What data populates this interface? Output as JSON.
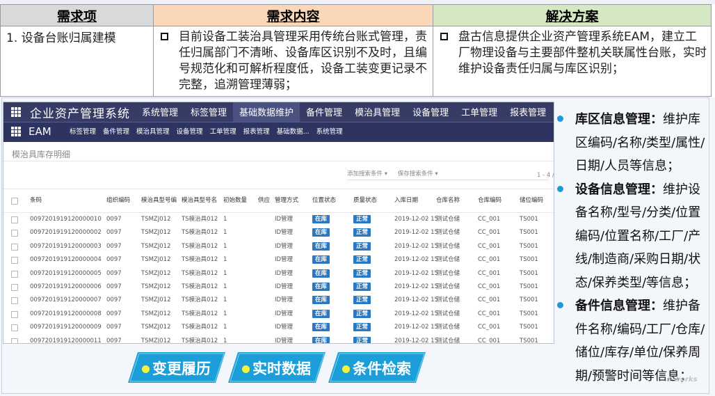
{
  "table": {
    "headers": [
      "需求项",
      "需求内容",
      "解决方案"
    ],
    "item": "1. 设备台账归属建模",
    "content": "目前设备工装治具管理采用传统台账式管理，责任归属部门不清晰、设备库区识别不及时，且编号规范化和可解析程度低，设备工装变更记录不完整，追溯管理薄弱；",
    "solution": "盘古信息提供企业资产管理系统EAM，建立工厂物理设备与主要部件整机关联属性台账，实时维护设备责任归属与库区识别；"
  },
  "app": {
    "title": "企业资产管理系统",
    "nav": [
      "系统管理",
      "标签管理",
      "基础数据维护",
      "备件管理",
      "模治具管理",
      "设备管理",
      "工单管理",
      "报表管理"
    ],
    "active_nav": "基础数据维护",
    "sub_title": "EAM",
    "sub_nav": [
      "标签管理",
      "备件管理",
      "模治具管理",
      "设备管理",
      "工单管理",
      "报表管理",
      "基础数据...",
      "系统管理"
    ],
    "page_title": "模治具库存明细",
    "add_search": "添加搜索条件 ▾",
    "saved_search": "保存搜索条件 ▾",
    "pager": "1 - 4 /",
    "columns": [
      "条码",
      "组织编码",
      "模治具型号编",
      "模治具型号名",
      "初始数量",
      "供应",
      "管理方式",
      "位置状态",
      "质量状态",
      "入库日期",
      "仓库名称",
      "仓库编码",
      "储位编码"
    ],
    "rows": [
      [
        "0097201919120000010",
        "0097",
        "TSMZJ012",
        "TS模治具012",
        "1",
        "",
        "ID管理",
        "在库",
        "正常",
        "2019-12-02 15",
        "测试仓储",
        "CC_001",
        "TS001"
      ],
      [
        "0097201919120000002",
        "0097",
        "TSMZJ012",
        "TS模治具012",
        "1",
        "",
        "ID管理",
        "在库",
        "正常",
        "2019-12-02 15",
        "测试仓储",
        "CC_001",
        "TS001"
      ],
      [
        "0097201919120000003",
        "0097",
        "TSMZJ012",
        "TS模治具012",
        "1",
        "",
        "ID管理",
        "在库",
        "正常",
        "2019-12-02 15",
        "测试仓储",
        "CC_001",
        "TS001"
      ],
      [
        "0097201919120000004",
        "0097",
        "TSMZJ012",
        "TS模治具012",
        "1",
        "",
        "ID管理",
        "在库",
        "正常",
        "2019-12-02 15",
        "测试仓储",
        "CC_001",
        "TS001"
      ],
      [
        "0097201919120000005",
        "0097",
        "TSMZJ012",
        "TS模治具012",
        "1",
        "",
        "ID管理",
        "在库",
        "正常",
        "2019-12-02 15",
        "测试仓储",
        "CC_001",
        "TS001"
      ],
      [
        "0097201919120000006",
        "0097",
        "TSMZJ012",
        "TS模治具012",
        "1",
        "",
        "ID管理",
        "在库",
        "正常",
        "2019-12-02 15",
        "测试仓储",
        "CC_001",
        "TS001"
      ],
      [
        "0097201919120000007",
        "0097",
        "TSMZJ012",
        "TS模治具012",
        "1",
        "",
        "ID管理",
        "在库",
        "正常",
        "2019-12-02 15",
        "测试仓储",
        "CC_001",
        "TS001"
      ],
      [
        "0097201919120000008",
        "0097",
        "TSMZJ012",
        "TS模治具012",
        "1",
        "",
        "ID管理",
        "在库",
        "正常",
        "2019-12-02 15",
        "测试仓储",
        "CC_001",
        "TS001"
      ],
      [
        "0097201919120000009",
        "0097",
        "TSMZJ012",
        "TS模治具012",
        "1",
        "",
        "ID管理",
        "在库",
        "正常",
        "2019-12-02 15",
        "测试仓储",
        "CC_001",
        "TS001"
      ],
      [
        "0097201919120000011",
        "0097",
        "TSMZJ012",
        "TS模治具012",
        "1",
        "",
        "ID管理",
        "在库",
        "正常",
        "2019-12-02 15",
        "测试仓储",
        "CC_001",
        "TS001"
      ]
    ]
  },
  "buttons": [
    "变更履历",
    "实时数据",
    "条件检索"
  ],
  "features": [
    {
      "title": "库区信息管理：",
      "text": "维护库区编码/名称/类型/属性/日期/人员等信息；"
    },
    {
      "title": "设备信息管理：",
      "text": "维护设备名称/型号/分类/位置编码/位置名称/工厂/产线/制造商/采购日期/状态/保养类型/等信息；"
    },
    {
      "title": "备件信息管理：",
      "text": "维护备件名称/编码/工厂/仓库/储位/库存/单位/保养周期/预警时间等信息；"
    }
  ],
  "watermark": "e-works",
  "colors": {
    "nav_bg": "#363c66",
    "tag_blue": "#2b78c2",
    "button_blue": "#1c9fd8",
    "bullet_blue": "#1b9ad6"
  }
}
